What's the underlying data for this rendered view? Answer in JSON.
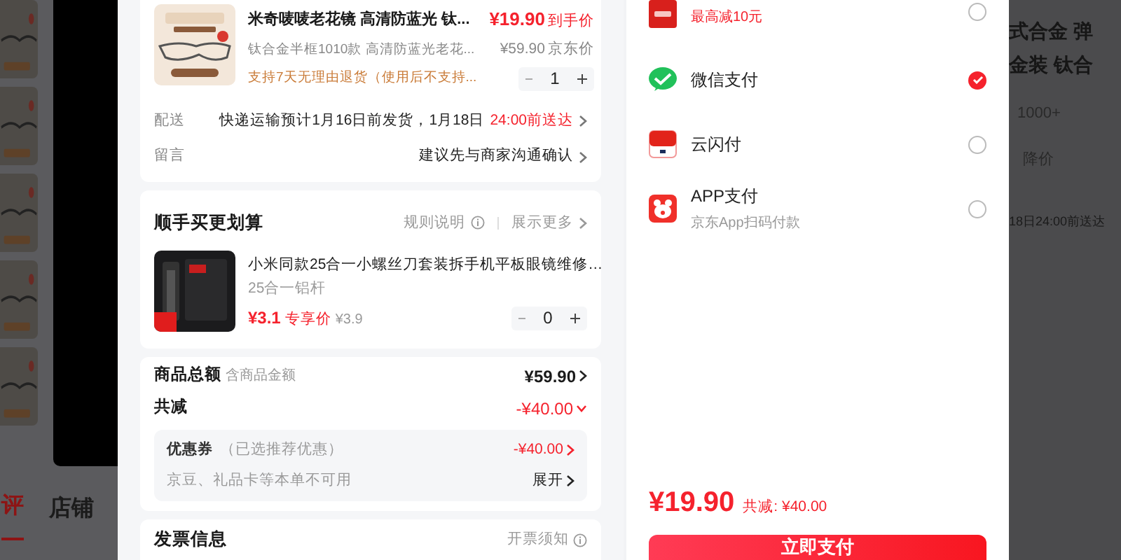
{
  "background_left": {
    "tabs": [
      {
        "label": "评",
        "selected": true
      },
      {
        "label": "店铺",
        "selected": false
      }
    ]
  },
  "background_right": {
    "texts": [
      "式合金 弹",
      "金装 钛合",
      "1000+",
      "降价",
      "18日24:00前送达"
    ]
  },
  "order": {
    "items": [
      {
        "title": "米奇唛唛老花镜 高清防蓝光 钛...",
        "spec": "钛合金半框1010款  高清防蓝光老花...",
        "notice": "支持7天无理由退货（使用后不支持...",
        "price": "¥19.90",
        "price_label": "到手价",
        "jd_price": "¥59.90",
        "jd_label": "京东价",
        "quantity": "1"
      }
    ],
    "delivery": {
      "label": "配送",
      "text": "快递运输预计1月16日前发货，1月18日",
      "highlight": "24:00前送达"
    },
    "message": {
      "label": "留言",
      "text": "建议先与商家沟通确认"
    }
  },
  "add_on": {
    "title": "顺手买更划算",
    "rule_link": "规则说明",
    "more_link": "展示更多",
    "items": [
      {
        "title": "小米同款25合一小螺丝刀套装拆手机平板眼镜维修…",
        "subtitle": "25合一铝杆",
        "price": "¥3.1",
        "price_label": "专享价",
        "original_price": "¥3.9",
        "quantity": "0"
      }
    ]
  },
  "summary": {
    "total_label": "商品总额",
    "total_note": "含商品金额",
    "total": "¥59.90",
    "discount_label": "共减",
    "discount": "-¥40.00",
    "coupon_label": "优惠券",
    "coupon_note": "（已选推荐优惠）",
    "coupon_value": "-¥40.00",
    "unavailable": "京豆、礼品卡等本单不可用",
    "expand": "展开"
  },
  "invoice": {
    "title": "发票信息",
    "note": "开票须知"
  },
  "payment": {
    "methods": [
      {
        "kind": "jdpay",
        "subtitle": "最高减10元",
        "selected": false
      },
      {
        "kind": "wechat",
        "name": "微信支付",
        "selected": true
      },
      {
        "kind": "unionpay",
        "name": "云闪付",
        "selected": false
      },
      {
        "kind": "app",
        "name": "APP支付",
        "subtitle": "京东App扫码付款",
        "selected": false
      }
    ],
    "total": "¥19.90",
    "discount": "共减: ¥40.00",
    "button": "立即支付"
  }
}
